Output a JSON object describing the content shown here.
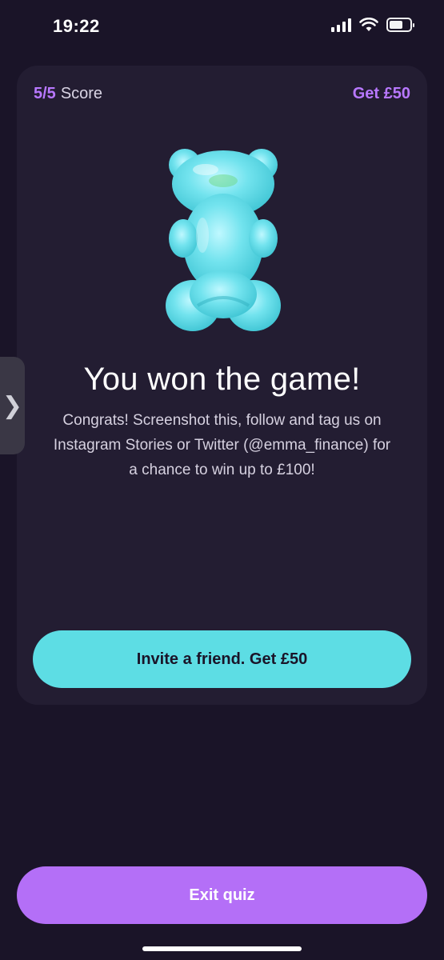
{
  "status_bar": {
    "time": "19:22",
    "icons": [
      "cellular-signal-icon",
      "wifi-icon",
      "battery-icon"
    ]
  },
  "card": {
    "score_value": "5/5",
    "score_label": "Score",
    "get_link": "Get £50",
    "illustration": "gummy-bear-icon",
    "title": "You won the game!",
    "body": "Congrats! Screenshot this, follow and tag us on Instagram Stories or Twitter (@emma_finance) for a chance to win up to £100!",
    "invite_button": "Invite a friend. Get £50"
  },
  "side_handle": {
    "glyph": "❯",
    "icon": "chevron-right-icon"
  },
  "exit_button": "Exit quiz",
  "colors": {
    "background": "#1a1428",
    "card": "#231d32",
    "accent_purple": "#b878ff",
    "accent_teal": "#5ddde4",
    "exit_button": "#b46ff7"
  }
}
